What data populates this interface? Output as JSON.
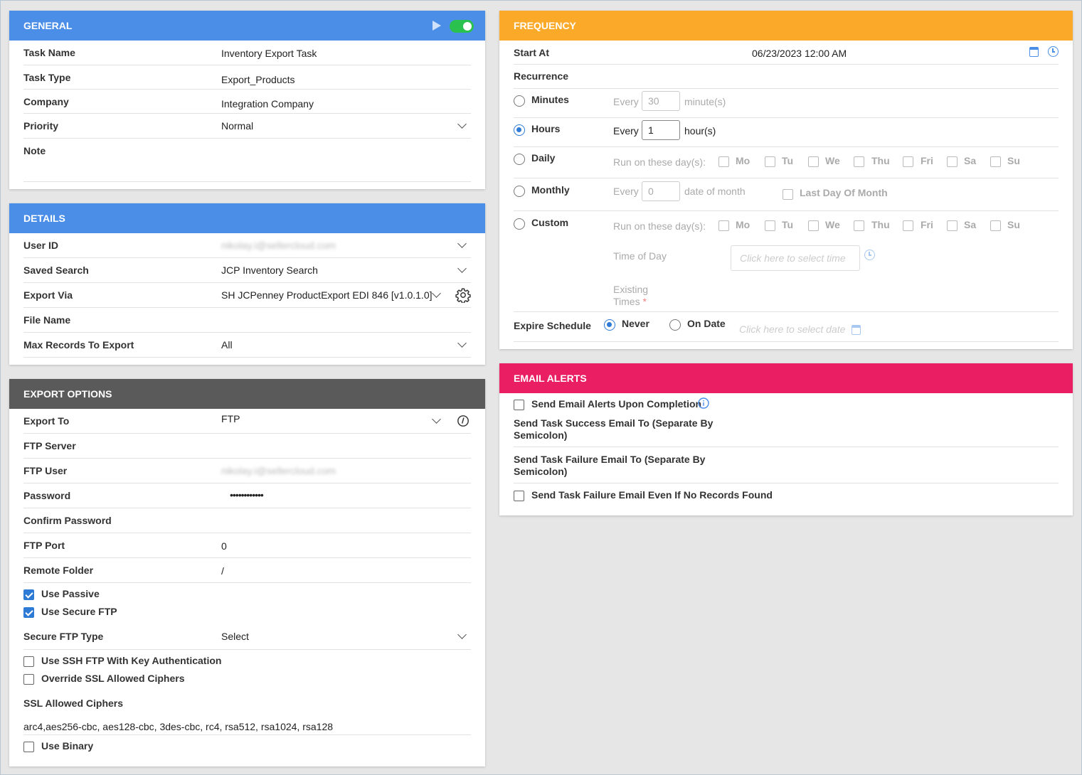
{
  "general": {
    "title": "GENERAL",
    "rows": [
      {
        "label": "Task Name",
        "value": "Inventory Export Task"
      },
      {
        "label": "Task Type",
        "value": "Export_Products"
      },
      {
        "label": "Company",
        "value": "Integration Company"
      },
      {
        "label": "Priority",
        "value": "Normal"
      },
      {
        "label": "Note",
        "value": ""
      }
    ]
  },
  "details": {
    "title": "DETAILS",
    "rows": [
      {
        "label": "User ID",
        "value": "nikolay.i@sellercloud.com"
      },
      {
        "label": "Saved Search",
        "value": "JCP Inventory Search"
      },
      {
        "label": "Export Via",
        "value": "SH JCPenney ProductExport EDI 846 [v1.0.1.0]"
      },
      {
        "label": "File Name",
        "value": ""
      },
      {
        "label": "Max Records To Export",
        "value": "All"
      }
    ]
  },
  "export_options": {
    "title": "EXPORT OPTIONS",
    "export_to": {
      "label": "Export To",
      "value": "FTP"
    },
    "ftp_server": {
      "label": "FTP Server",
      "value": ""
    },
    "ftp_user": {
      "label": "FTP User",
      "value": "nikolay.i@sellercloud.com"
    },
    "password": {
      "label": "Password",
      "value": "••••••••••••"
    },
    "confirm_password": {
      "label": "Confirm Password",
      "value": ""
    },
    "ftp_port": {
      "label": "FTP Port",
      "value": "0"
    },
    "remote_folder": {
      "label": "Remote Folder",
      "value": "/"
    },
    "use_passive": {
      "label": "Use Passive",
      "checked": true
    },
    "use_secure_ftp": {
      "label": "Use Secure FTP",
      "checked": true
    },
    "secure_ftp_type": {
      "label": "Secure FTP Type",
      "value": "Select"
    },
    "use_ssh": {
      "label": "Use SSH FTP With Key Authentication",
      "checked": false
    },
    "override_ssl": {
      "label": "Override SSL Allowed Ciphers",
      "checked": false
    },
    "ssl_allowed_ciphers": {
      "label": "SSL Allowed Ciphers",
      "value": "arc4,aes256-cbc, aes128-cbc, 3des-cbc, rc4, rsa512, rsa1024, rsa128"
    },
    "use_binary": {
      "label": "Use Binary",
      "checked": false
    }
  },
  "frequency": {
    "title": "FREQUENCY",
    "start_at": {
      "label": "Start At",
      "value": "06/23/2023 12:00 AM"
    },
    "recurrence_label": "Recurrence",
    "every": "Every",
    "minutes": {
      "label": "Minutes",
      "value": "30",
      "unit": "minute(s)"
    },
    "hours": {
      "label": "Hours",
      "value": "1",
      "unit": "hour(s)"
    },
    "daily": {
      "label": "Daily",
      "run_on": "Run on these day(s):"
    },
    "monthly": {
      "label": "Monthly",
      "value": "0",
      "unit": "date of month",
      "last_day": "Last Day Of Month"
    },
    "custom": {
      "label": "Custom",
      "run_on": "Run on these day(s):",
      "time_of_day": "Time of Day",
      "time_placeholder": "Click here to select time",
      "existing_times_1": "Existing",
      "existing_times_2": "Times",
      "required": "*"
    },
    "days": [
      "Mo",
      "Tu",
      "We",
      "Thu",
      "Fri",
      "Sa",
      "Su"
    ],
    "expire": {
      "label": "Expire Schedule",
      "never": "Never",
      "on_date": "On Date",
      "date_placeholder": "Click here to select date"
    }
  },
  "email_alerts": {
    "title": "EMAIL ALERTS",
    "send_upon_completion": "Send Email Alerts Upon Completion",
    "success_label_1": "Send Task Success Email To (Separate By",
    "success_label_2": "Semicolon)",
    "failure_label_1": "Send Task Failure Email To (Separate By",
    "failure_label_2": "Semicolon)",
    "failure_no_records": "Send Task Failure Email Even If No Records Found"
  },
  "colors": {
    "general_header": "#4a8ee8",
    "export_header": "#5a5a5a",
    "frequency_header": "#fba928",
    "email_header": "#e91e63",
    "toggle_on": "#2bc14f"
  }
}
